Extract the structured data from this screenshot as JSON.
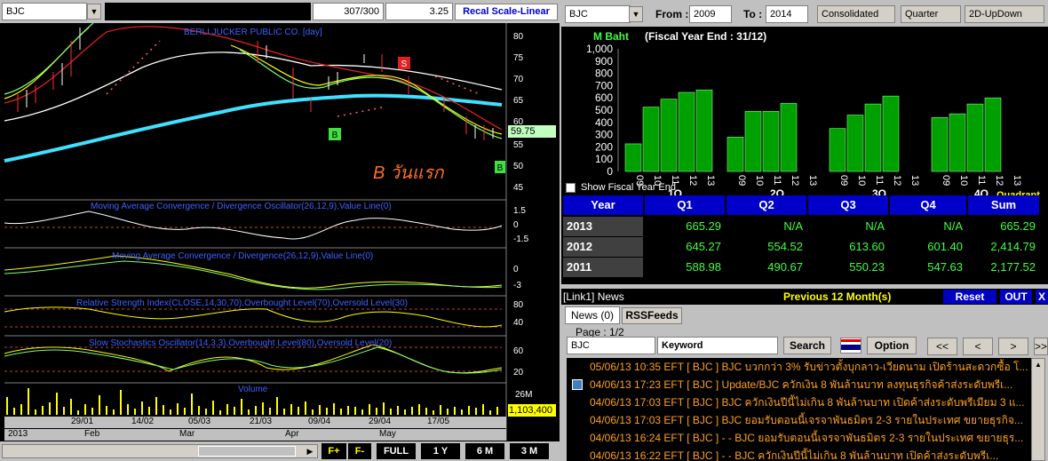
{
  "left_panel": {
    "symbol": "BJC",
    "counter": "307/300",
    "value": "3.25",
    "scale_button": "Recal Scale-Linear",
    "chart_title": "BERLI JUCKER PUBLIC CO. [day]",
    "annotation": "B วันแรก",
    "last_price": "59.75",
    "last_volume": "1,103,400",
    "signal_labels": [
      "B",
      "B",
      "S"
    ],
    "price_ticks": [
      "80",
      "75",
      "70",
      "65",
      "60",
      "55",
      "50",
      "45"
    ],
    "panels": [
      {
        "title": "Moving Average Convergence / Divergence Oscillator(26,12,9),Value Line(0)",
        "ticks": [
          "1.5",
          "0",
          "-1.5"
        ]
      },
      {
        "title": "Moving Average Convergence / Divergence(26,12,9),Value Line(0)",
        "ticks": [
          "0",
          "-3"
        ]
      },
      {
        "title": "Relative Strength Index(CLOSE,14,30,70),Overbought Level(70),Oversold Level(30)",
        "ticks": [
          "80",
          "40"
        ]
      },
      {
        "title": "Slow Stochastics Oscillator(14,3,3),Overbought Level(80),Oversold Level(20)",
        "ticks": [
          "60",
          "20"
        ]
      },
      {
        "title": "Volume",
        "ticks": [
          "26M"
        ]
      }
    ],
    "date_labels": [
      "29/01",
      "14/02",
      "05/03",
      "21/03",
      "09/04",
      "29/04",
      "17/05"
    ],
    "month_labels": [
      "2013",
      "Feb",
      "Mar",
      "Apr",
      "May"
    ],
    "toolbar": {
      "f_plus": "F+",
      "f_minus": "F-",
      "full": "FULL",
      "y1": "1 Y",
      "m6": "6 M",
      "m3": "3 M"
    }
  },
  "right_panel": {
    "symbol": "BJC",
    "from_label": "From :",
    "from_value": "2009",
    "to_label": "To :",
    "to_value": "2014",
    "consolidated": "Consolidated",
    "period": "Quarter",
    "mode": "2D-UpDown",
    "unit_label": "M Baht",
    "fiscal_label": "(Fiscal Year End : 31/12)",
    "show_fiscal": "Show Fiscal Year End",
    "quadrant_label": "Quadrant",
    "table": {
      "headers": [
        "Year",
        "Q1",
        "Q2",
        "Q3",
        "Q4",
        "Sum"
      ],
      "rows": [
        [
          "2013",
          "665.29",
          "N/A",
          "N/A",
          "N/A",
          "665.29"
        ],
        [
          "2012",
          "645.27",
          "554.52",
          "613.60",
          "601.40",
          "2,414.79"
        ],
        [
          "2011",
          "588.98",
          "490.67",
          "550.23",
          "547.63",
          "2,177.52"
        ]
      ]
    },
    "news": {
      "link_label": "[Link1] News",
      "previous_label": "Previous 12 Month(s)",
      "reset": "Reset",
      "out": "OUT",
      "close": "X",
      "tab_news": "News (0)",
      "tab_rss": "RSSFeeds",
      "page": "Page : 1/2",
      "search_symbol": "BJC",
      "keyword": "Keyword",
      "search_btn": "Search",
      "option_btn": "Option",
      "nav": [
        "<<",
        "<",
        ">",
        ">>"
      ],
      "items": [
        {
          "date": "05/06/13 10:35",
          "src": "EFT",
          "sym": "[ BJC ]",
          "text": "BJC บวกกว่า 3% รับข่าวตั้งบุกลาว-เวียดนาม เปิดร้านสะดวกซื้อ โ..."
        },
        {
          "date": "04/06/13 17:23",
          "src": "EFT",
          "sym": "[ BJC ]",
          "text": "Update/BJC ควักเงิน 8 พันล้านบาท ลงทุนธุรกิจค้าส่งระดับพรีเ..."
        },
        {
          "date": "04/06/13 17:03",
          "src": "EFT",
          "sym": "[ BJC ]",
          "text": "BJC ควักเงินปีนี้ไม่เกิน 8 พันล้านบาท เปิดค้าส่งระดับพรีเมียม 3 แ..."
        },
        {
          "date": "04/06/13 17:03",
          "src": "EFT",
          "sym": "[ BJC ]",
          "text": "BJC ยอมรับตอนนี้เจรจาพันธมิตร 2-3 รายในประเทศ ขยายธุรกิจ..."
        },
        {
          "date": "04/06/13 16:24",
          "src": "EFT",
          "sym": "[ BJC ]",
          "text": "- - BJC ยอมรับตอนนี้เจรจาพันธมิตร 2-3 รายในประเทศ ขยายธุร..."
        },
        {
          "date": "04/06/13 16:22",
          "src": "EFT",
          "sym": "[ BJC ]",
          "text": "- - BJC ควักเงินปีนี้ไม่เกิน 8 พันล้านบาท เปิดค้าส่งระดับพรีเ..."
        }
      ]
    }
  },
  "chart_data": {
    "type": "bar",
    "title": "M Baht",
    "ylim": [
      0,
      1000
    ],
    "yticks": [
      "1,000",
      "900",
      "800",
      "700",
      "600",
      "500",
      "400",
      "300",
      "200",
      "100",
      "0"
    ],
    "groups": [
      {
        "quarter": "Q1",
        "categories": [
          "09",
          "10",
          "11",
          "12",
          "13"
        ],
        "values": [
          225,
          525,
          590,
          645,
          665
        ]
      },
      {
        "quarter": "Q2",
        "categories": [
          "09",
          "10",
          "11",
          "12",
          "13"
        ],
        "values": [
          280,
          490,
          490,
          555,
          0
        ]
      },
      {
        "quarter": "Q3",
        "categories": [
          "09",
          "10",
          "11",
          "12",
          "13"
        ],
        "values": [
          350,
          460,
          550,
          615,
          0
        ]
      },
      {
        "quarter": "Q4",
        "categories": [
          "09",
          "10",
          "11",
          "12",
          "13"
        ],
        "values": [
          440,
          470,
          550,
          600,
          0
        ]
      }
    ],
    "group_labels": [
      "1Q",
      "2Q",
      "3Q",
      "4Q"
    ],
    "colors": {
      "bar": "#00a000",
      "bar_edge": "#80ff80"
    }
  }
}
